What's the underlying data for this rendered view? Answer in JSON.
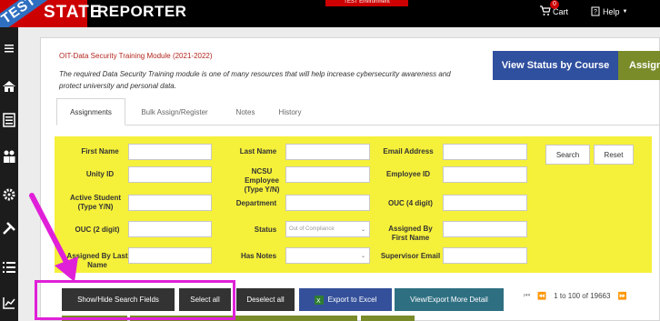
{
  "header": {
    "test_ribbon": "TEST",
    "brand": "STATE",
    "app_title": "REPORTER",
    "env_badge": "TEST Environment",
    "cart_count": "0",
    "cart_label": "Cart",
    "help_label": "Help"
  },
  "module": {
    "title": "OIT-Data Security Training Module (2021-2022)",
    "description": "The required Data Security Training module is one of many resources that will help increase cybersecurity awareness and protect university and personal data.",
    "view_status_label": "View Status by Course",
    "assign_label": "Assign"
  },
  "tabs": [
    {
      "label": "Assignments"
    },
    {
      "label": "Bulk Assign/Register"
    },
    {
      "label": "Notes"
    },
    {
      "label": "History"
    }
  ],
  "search": {
    "first_name": "First Name",
    "last_name": "Last Name",
    "email": "Email Address",
    "unity_id": "Unity ID",
    "ncsu_employee": "NCSU Employee (Type Y/N)",
    "employee_id": "Employee ID",
    "active_student": "Active Student (Type Y/N)",
    "department": "Department",
    "ouc4": "OUC (4 digit)",
    "ouc2": "OUC (2 digit)",
    "status": "Status",
    "status_value": "Out of Compliance",
    "assigned_by_first": "Assigned By First Name",
    "assigned_by_last": "Assigned By Last Name",
    "has_notes": "Has Notes",
    "supervisor_email": "Supervisor Email",
    "search_btn": "Search",
    "reset_btn": "Reset"
  },
  "actions": {
    "show_hide": "Show/Hide Search Fields",
    "select_all": "Select all",
    "deselect_all": "Deselect all",
    "export_excel": "Export to Excel",
    "view_export_more": "View/Export More Detail",
    "pagination_text": "1 to 100 of 19663"
  },
  "colors": {
    "highlight": "#e020d8",
    "search_bg": "#f5f03a",
    "brand_red": "#cc0000"
  },
  "icons": [
    "hamburger-icon",
    "home-icon",
    "report-icon",
    "users-icon",
    "gears-icon",
    "tools-icon",
    "list-icon",
    "chart-icon",
    "cart-icon",
    "help-icon",
    "first-page-icon",
    "prev-page-icon",
    "next-page-icon"
  ]
}
